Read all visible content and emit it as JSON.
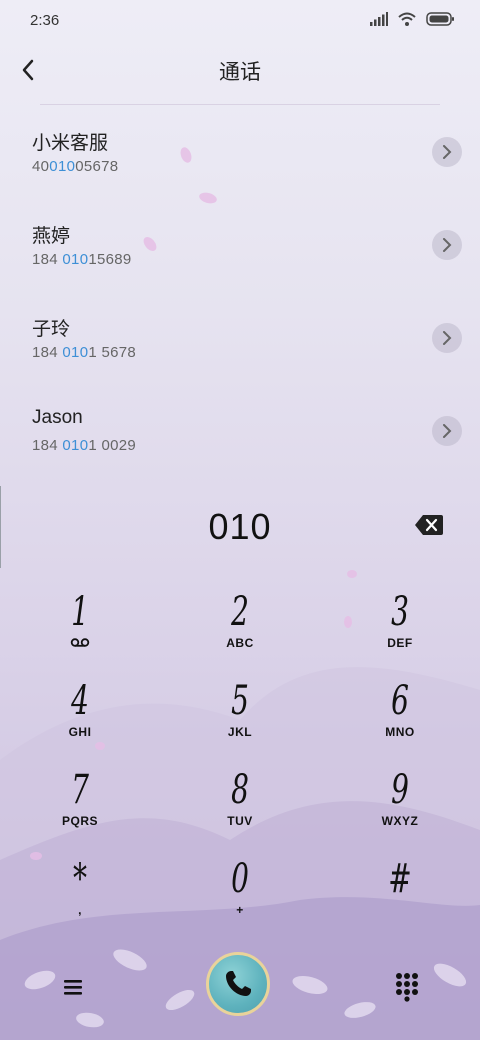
{
  "status_bar": {
    "time": "2:36",
    "icons": [
      "signal-icon",
      "wifi-icon",
      "battery-icon"
    ]
  },
  "header": {
    "title": "通话",
    "back_icon": "chevron-left-icon"
  },
  "contacts": [
    {
      "name": "小米客服",
      "number_pre": "40",
      "number_match": "010",
      "number_post": "05678"
    },
    {
      "name": "燕婷",
      "number_pre": "184 ",
      "number_match": "010",
      "number_post": "15689"
    },
    {
      "name": "子玲",
      "number_pre": "184 ",
      "number_match": "010",
      "number_post": "1 5678"
    },
    {
      "name": "Jason",
      "number_pre": "184 ",
      "number_match": "010",
      "number_post": "1 0029"
    }
  ],
  "dialer": {
    "input_value": "010",
    "delete_icon": "backspace-icon"
  },
  "keypad": [
    {
      "digit": "1",
      "letters": "",
      "icon": "voicemail-icon"
    },
    {
      "digit": "2",
      "letters": "ABC"
    },
    {
      "digit": "3",
      "letters": "DEF"
    },
    {
      "digit": "4",
      "letters": "GHI"
    },
    {
      "digit": "5",
      "letters": "JKL"
    },
    {
      "digit": "6",
      "letters": "MNO"
    },
    {
      "digit": "7",
      "letters": "PQRS"
    },
    {
      "digit": "8",
      "letters": "TUV"
    },
    {
      "digit": "9",
      "letters": "WXYZ"
    },
    {
      "digit": "*",
      "letters": ","
    },
    {
      "digit": "0",
      "letters": "+"
    },
    {
      "digit": "#",
      "letters": ""
    }
  ],
  "bottom_bar": {
    "menu_icon": "menu-icon",
    "call_icon": "phone-icon",
    "dialpad_icon": "dialpad-icon"
  },
  "colors": {
    "highlight": "#3d8fd6",
    "call_button": "#5eb2bd",
    "call_ring": "#e9d39a"
  }
}
